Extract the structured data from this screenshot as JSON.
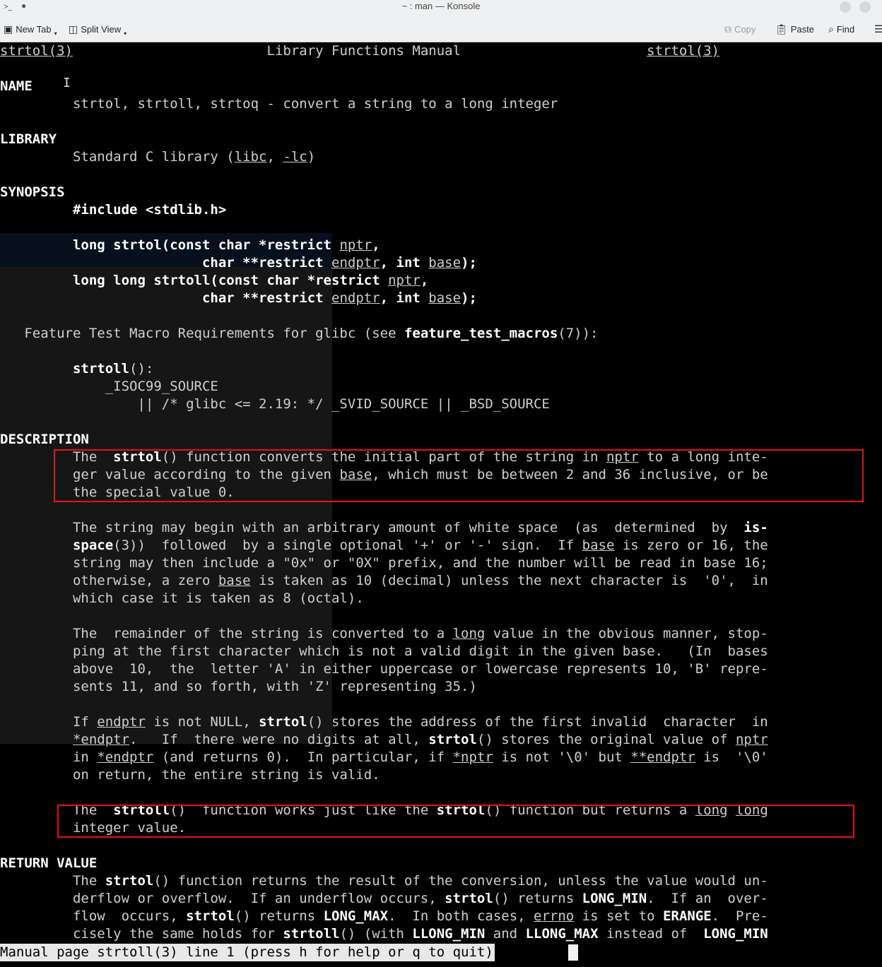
{
  "window": {
    "title": "~ : man — Konsole"
  },
  "toolbar": {
    "new_tab": "New Tab",
    "split_view": "Split View",
    "copy": "Copy",
    "paste": "Paste",
    "find": "Find",
    "icons": [
      "terminal-icon",
      "split-view-icon",
      "copy-icon",
      "paste-icon",
      "search-icon",
      "menu-icon"
    ]
  },
  "man": {
    "header_left": "strtol(3)",
    "header_center": "Library Functions Manual",
    "header_right": "strtol(3)",
    "sections": {
      "name": "NAME",
      "library": "LIBRARY",
      "synopsis": "SYNOPSIS",
      "description": "DESCRIPTION",
      "return_value": "RETURN VALUE"
    },
    "name_line": "strtol, strtoll, strtoq - convert a string to a long integer",
    "library_line": "Standard C library (libc, -lc)",
    "status_line": "Manual page strtoll(3) line 1 (press h for help or q to quit)"
  },
  "highlight_color": "#e8101a"
}
